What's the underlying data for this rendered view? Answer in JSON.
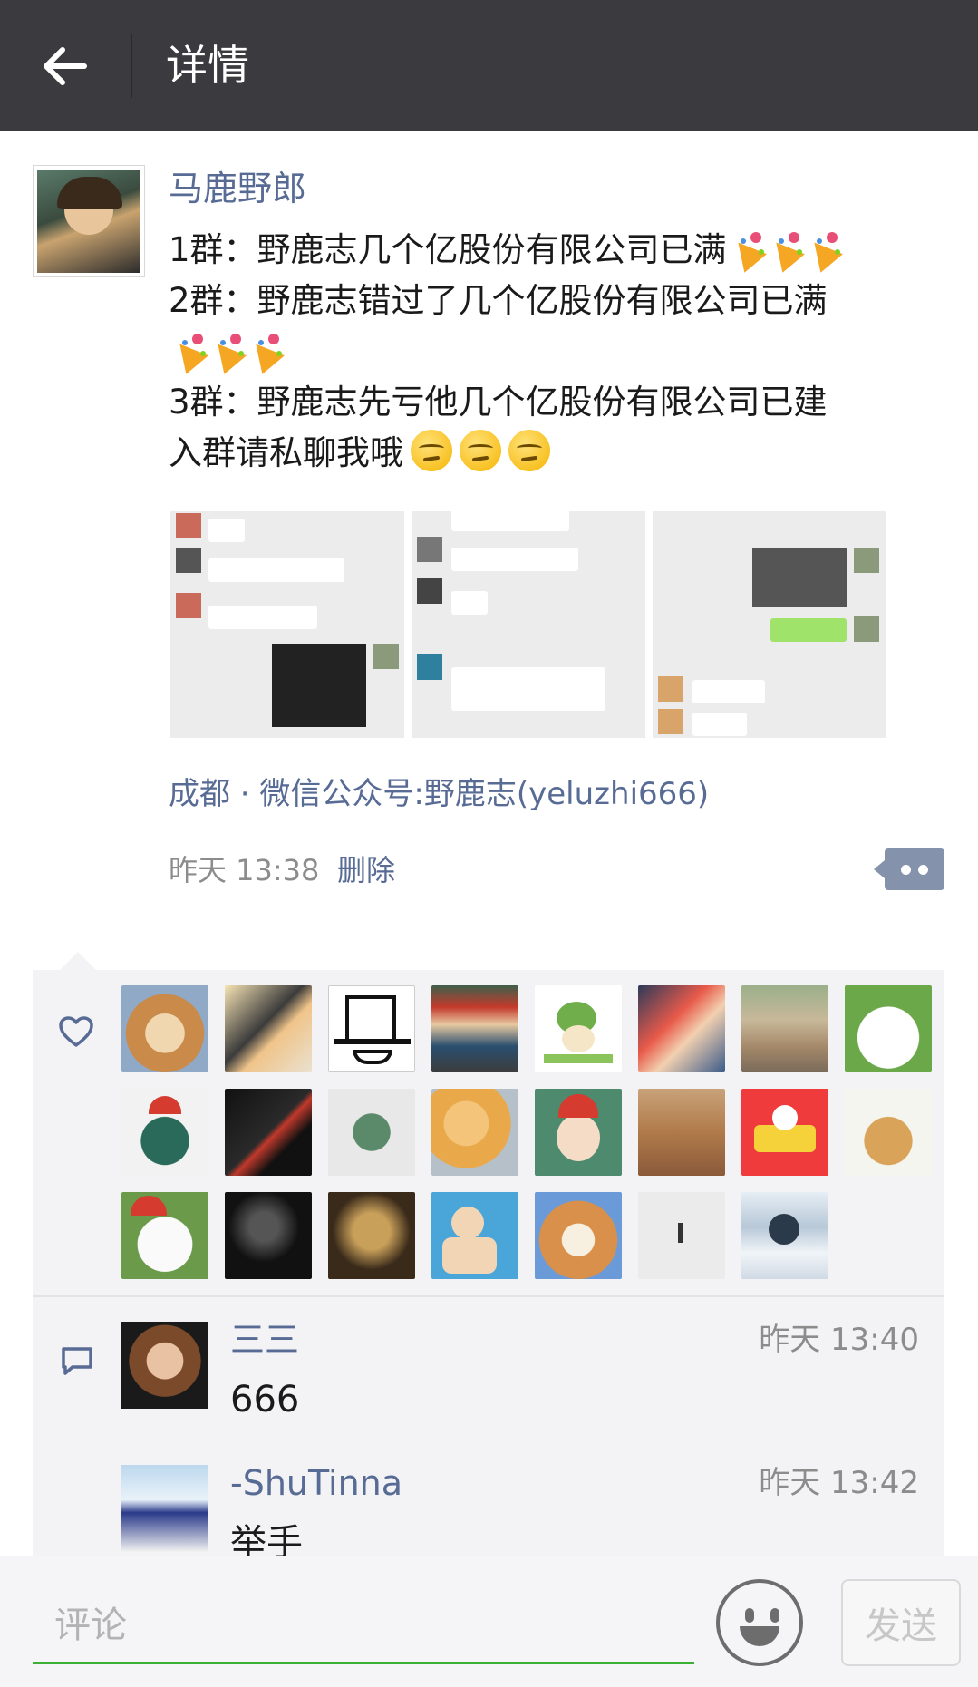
{
  "header": {
    "title": "详情",
    "back_icon": "arrow-left-icon"
  },
  "post": {
    "author": "马鹿野郎",
    "lines": [
      "1群：野鹿志几个亿股份有限公司已满",
      "2群：野鹿志错过了几个亿股份有限公司已满",
      "3群：野鹿志先亏他几个亿股份有限公司已建",
      "入群请私聊我哦"
    ],
    "emojis": {
      "line1": "party-popper-icon x3",
      "line2": "party-popper-icon x3",
      "line4": "smirk-face-icon x3"
    },
    "image_count": 3,
    "location": "成都 · 微信公众号:野鹿志(yeluzhi666)",
    "time": "昨天 13:38",
    "delete_label": "删除"
  },
  "likes": {
    "icon": "heart-icon",
    "count": 23
  },
  "comments": [
    {
      "name": "三三",
      "time": "昨天 13:40",
      "text": "666"
    },
    {
      "name": "-ShuTinna",
      "time": "昨天 13:42",
      "text": "举手"
    }
  ],
  "bottom_bar": {
    "placeholder": "评论",
    "send_label": "发送",
    "emoji_icon": "smiley-face-icon"
  },
  "colors": {
    "header_bg": "#3b3b3f",
    "link_blue": "#576b95",
    "accent_green": "#3cb034",
    "social_bg": "#f3f3f5"
  }
}
